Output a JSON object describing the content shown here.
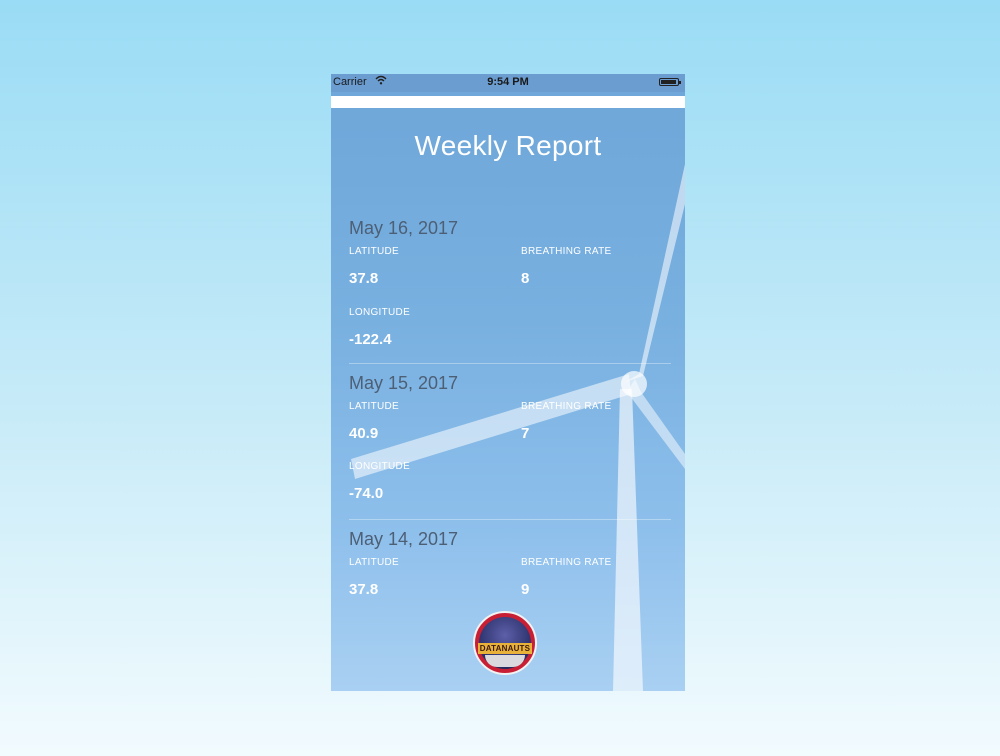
{
  "status": {
    "carrier": "Carrier",
    "time": "9:54 PM",
    "wifi_icon": "wifi-icon",
    "battery_icon": "battery-icon"
  },
  "page": {
    "title": "Weekly Report"
  },
  "labels": {
    "latitude": "LATITUDE",
    "longitude": "LONGITUDE",
    "breathing_rate": "BREATHING RATE"
  },
  "entries": [
    {
      "date": "May 16, 2017",
      "latitude": "37.8",
      "breathing_rate": "8",
      "longitude": "-122.4"
    },
    {
      "date": "May 15, 2017",
      "latitude": "40.9",
      "breathing_rate": "7",
      "longitude": "-74.0"
    },
    {
      "date": "May 14, 2017",
      "latitude": "37.8",
      "breathing_rate": "9"
    }
  ],
  "logo": {
    "text": "DATANAUTS",
    "icon": "datanauts-logo",
    "color": "#c81f35"
  },
  "colors": {
    "screen_top": "#6ea6d9",
    "date_text": "#4d5f75"
  }
}
